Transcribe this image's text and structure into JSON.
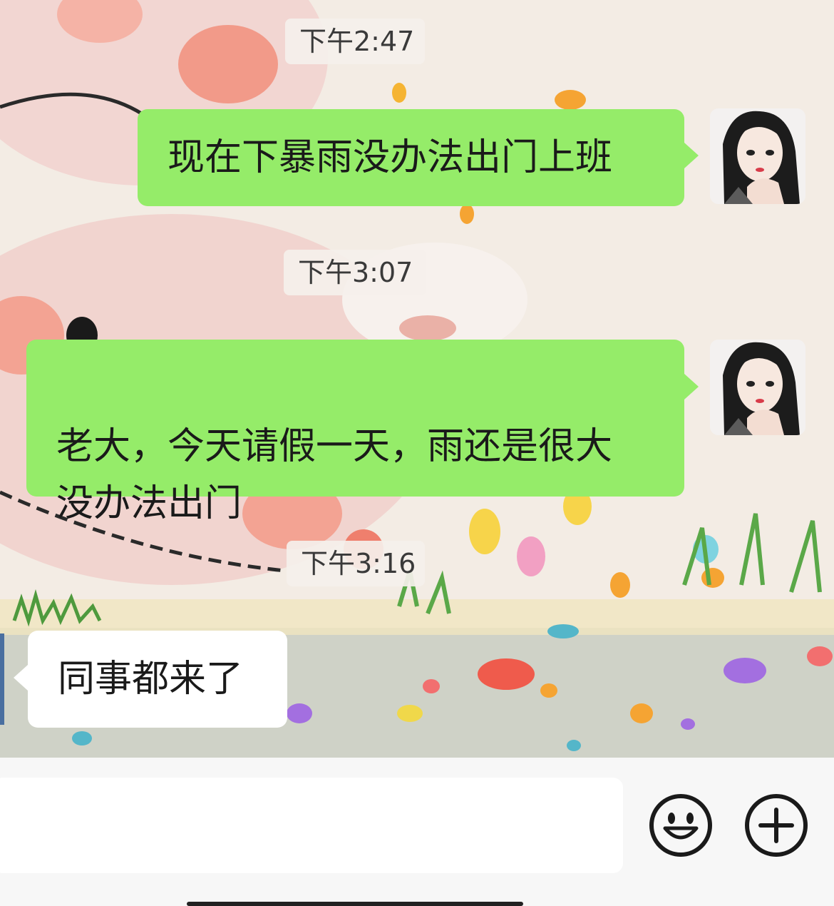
{
  "messages": [
    {
      "type": "timestamp",
      "text": "下午2:47"
    },
    {
      "type": "outgoing",
      "text": "现在下暴雨没办法出门上班"
    },
    {
      "type": "timestamp",
      "text": "下午3:07"
    },
    {
      "type": "outgoing",
      "text": "老大，今天请假一天，雨还是很大\n没办法出门"
    },
    {
      "type": "timestamp",
      "text": "下午3:16"
    },
    {
      "type": "incoming",
      "text": "同事都来了"
    }
  ],
  "input": {
    "value": ""
  },
  "icons": {
    "emoji": "smiley-icon",
    "more": "plus-circle-icon"
  },
  "colors": {
    "outgoing_bubble": "#95ec69",
    "incoming_bubble": "#ffffff"
  }
}
